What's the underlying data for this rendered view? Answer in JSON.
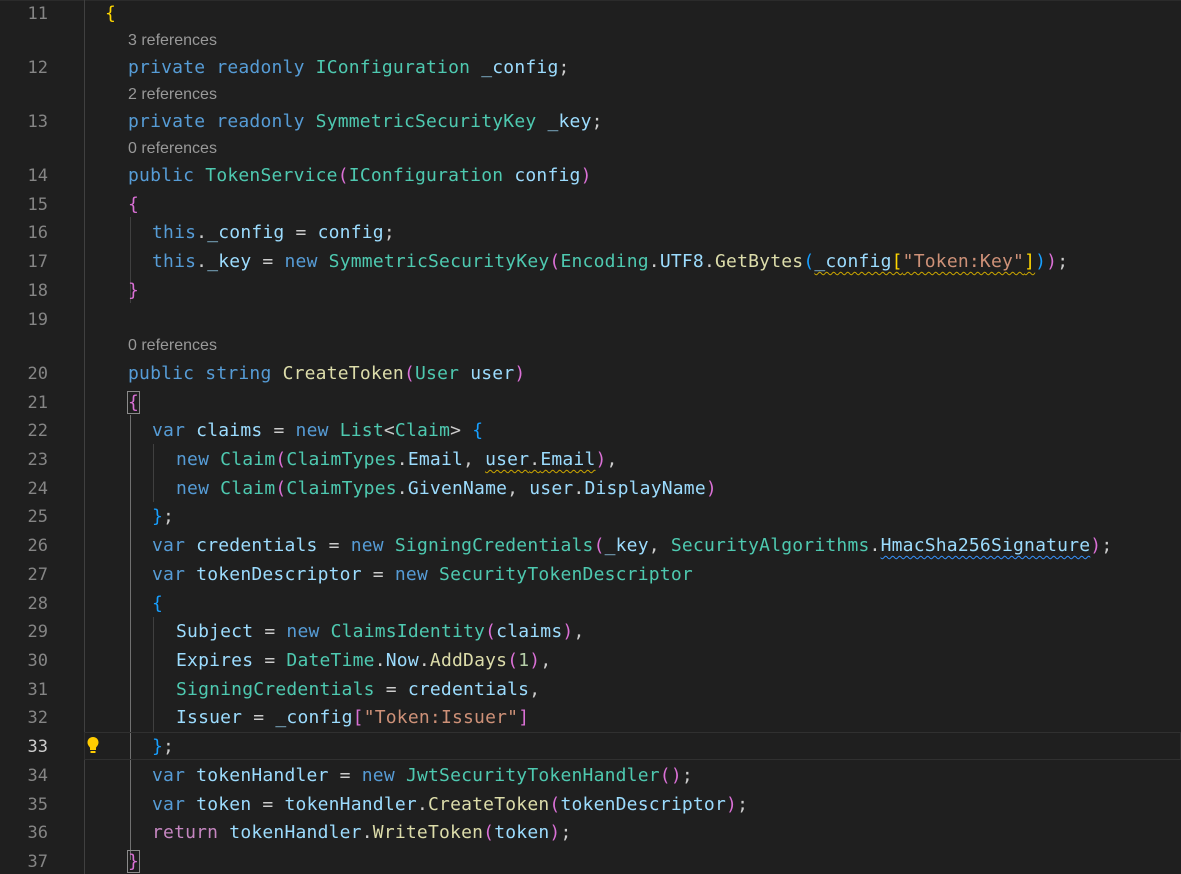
{
  "editor": {
    "language": "C#",
    "codelens": {
      "l12": "3 references",
      "l13": "2 references",
      "l14": "0 references",
      "l20": "0 references"
    },
    "lines": [
      {
        "n": "11",
        "code": "{"
      },
      {
        "n": "12",
        "code": "private readonly IConfiguration _config;"
      },
      {
        "n": "13",
        "code": "private readonly SymmetricSecurityKey _key;"
      },
      {
        "n": "14",
        "code": "public TokenService(IConfiguration config)"
      },
      {
        "n": "15",
        "code": "{"
      },
      {
        "n": "16",
        "code": "this._config = config;"
      },
      {
        "n": "17",
        "code": "this._key = new SymmetricSecurityKey(Encoding.UTF8.GetBytes(_config[\"Token:Key\"]));"
      },
      {
        "n": "18",
        "code": "}"
      },
      {
        "n": "19",
        "code": ""
      },
      {
        "n": "20",
        "code": "public string CreateToken(User user)"
      },
      {
        "n": "21",
        "code": "{"
      },
      {
        "n": "22",
        "code": "var claims = new List<Claim> {"
      },
      {
        "n": "23",
        "code": "new Claim(ClaimTypes.Email, user.Email),"
      },
      {
        "n": "24",
        "code": "new Claim(ClaimTypes.GivenName, user.DisplayName)"
      },
      {
        "n": "25",
        "code": "};"
      },
      {
        "n": "26",
        "code": "var credentials = new SigningCredentials(_key, SecurityAlgorithms.HmacSha256Signature);"
      },
      {
        "n": "27",
        "code": "var tokenDescriptor = new SecurityTokenDescriptor"
      },
      {
        "n": "28",
        "code": "{"
      },
      {
        "n": "29",
        "code": "Subject = new ClaimsIdentity(claims),"
      },
      {
        "n": "30",
        "code": "Expires = DateTime.Now.AddDays(1),"
      },
      {
        "n": "31",
        "code": "SigningCredentials = credentials,"
      },
      {
        "n": "32",
        "code": "Issuer = _config[\"Token:Issuer\"]"
      },
      {
        "n": "33",
        "code": "};"
      },
      {
        "n": "34",
        "code": "var tokenHandler = new JwtSecurityTokenHandler();"
      },
      {
        "n": "35",
        "code": "var token = tokenHandler.CreateToken(tokenDescriptor);"
      },
      {
        "n": "36",
        "code": "return tokenHandler.WriteToken(token);"
      },
      {
        "n": "37",
        "code": "}"
      }
    ],
    "active_line": "33",
    "lightbulb_icon": "lightbulb-icon",
    "colors": {
      "background": "#1f1f1f",
      "keyword": "#569cd6",
      "control_keyword": "#c586c0",
      "type": "#4ec9b0",
      "function": "#dcdcaa",
      "identifier": "#9cdcfe",
      "string": "#ce9178",
      "number": "#b5cea8",
      "bracket_level1": "#ffd700",
      "bracket_level2": "#da70d6",
      "bracket_level3": "#179fff",
      "warning_squiggle": "#cca700",
      "info_squiggle": "#3794ff",
      "lightbulb": "#ffcc00"
    }
  }
}
